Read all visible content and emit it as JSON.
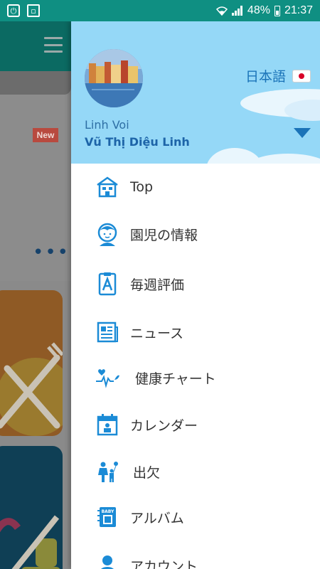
{
  "status_bar": {
    "battery": "48%",
    "time": "21:37",
    "icons": [
      "power-icon",
      "screenshot-icon",
      "wifi-icon",
      "signal-icon",
      "battery-icon"
    ]
  },
  "background_app": {
    "new_badge": "New",
    "more_label": "•••"
  },
  "drawer": {
    "language": {
      "label": "日本語",
      "flag": "japan-flag-icon"
    },
    "user": {
      "name": "Linh Voi",
      "full_name": "Vũ Thị Diệu Linh"
    },
    "menu": [
      {
        "label": "Top",
        "icon": "school-house-icon"
      },
      {
        "label": "園児の情報",
        "icon": "child-face-icon"
      },
      {
        "label": "毎週評価",
        "icon": "clipboard-grade-icon"
      },
      {
        "label": "ニュース",
        "icon": "newspaper-icon"
      },
      {
        "label": "健康チャート",
        "icon": "heartbeat-chart-icon"
      },
      {
        "label": "カレンダー",
        "icon": "calendar-icon"
      },
      {
        "label": "出欠",
        "icon": "attendance-family-icon"
      },
      {
        "label": "アルバム",
        "icon": "baby-album-icon"
      },
      {
        "label": "アカウント",
        "icon": "account-person-icon"
      }
    ]
  },
  "colors": {
    "status_bar": "#0f8f82",
    "drawer_header": "#95d8f7",
    "accent_blue": "#1a73b8",
    "icon_blue": "#1b8bd6",
    "flag_red": "#d80027"
  }
}
